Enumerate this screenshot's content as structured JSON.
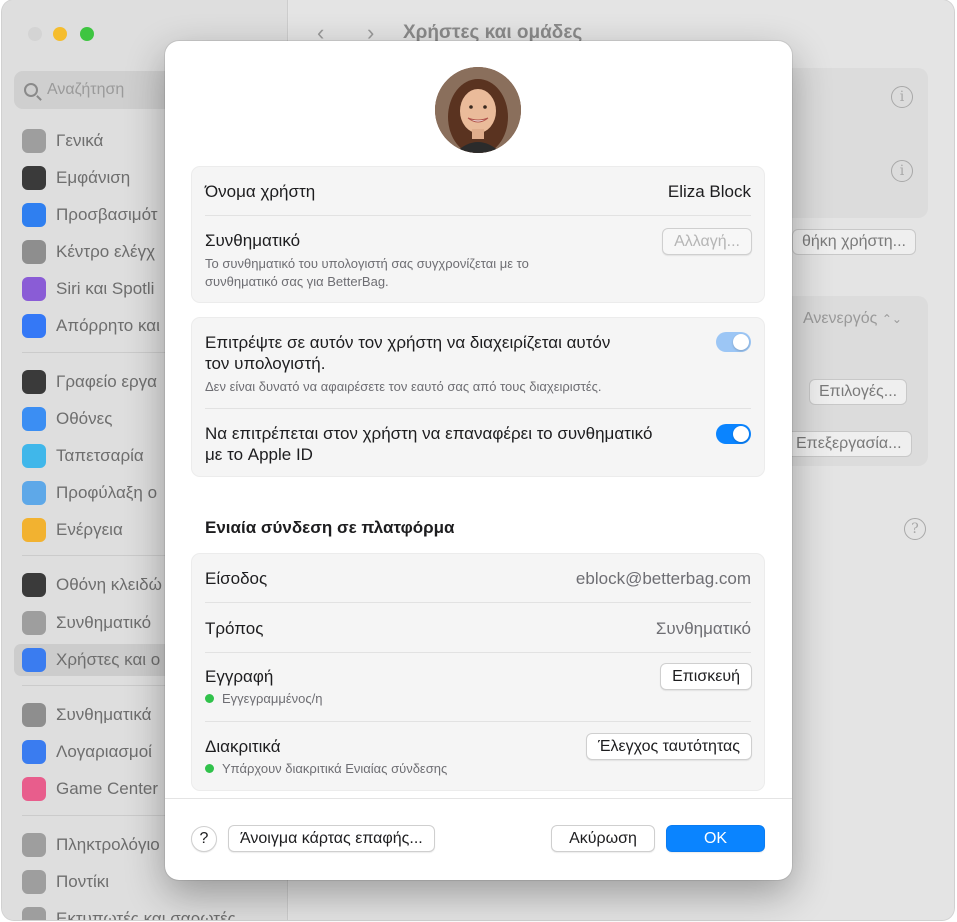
{
  "window": {
    "title": "Χρήστες και ομάδες"
  },
  "search": {
    "placeholder": "Αναζήτηση"
  },
  "sidebar": {
    "items": [
      {
        "label": "Γενικά",
        "icon": "gear-icon",
        "color": "#9e9e9e"
      },
      {
        "label": "Εμφάνιση",
        "icon": "appearance-icon",
        "color": "#3a3a3a"
      },
      {
        "label": "Προσβασιμότ",
        "icon": "accessibility-icon",
        "color": "#2f7ff0"
      },
      {
        "label": "Κέντρο ελέγχ",
        "icon": "control-center-icon",
        "color": "#8e8e8e"
      },
      {
        "label": "Siri και Spotli",
        "icon": "siri-icon",
        "color": "#8a5cd6"
      },
      {
        "label": "Απόρρητο και",
        "icon": "hand-icon",
        "color": "#3478f6"
      },
      {
        "label": "Γραφείο εργα",
        "icon": "desktop-icon",
        "color": "#3a3a3a"
      },
      {
        "label": "Οθόνες",
        "icon": "displays-icon",
        "color": "#3b8ef3"
      },
      {
        "label": "Ταπετσαρία",
        "icon": "wallpaper-icon",
        "color": "#40b7ea"
      },
      {
        "label": "Προφύλαξη ο",
        "icon": "screensaver-icon",
        "color": "#5ea8e8"
      },
      {
        "label": "Ενέργεια",
        "icon": "energy-icon",
        "color": "#f2b230"
      },
      {
        "label": "Οθόνη κλειδώ",
        "icon": "lock-screen-icon",
        "color": "#3a3a3a"
      },
      {
        "label": "Συνθηματικό",
        "icon": "password-lock-icon",
        "color": "#9e9e9e"
      },
      {
        "label": "Χρήστες και ο",
        "icon": "users-icon",
        "color": "#3a7cf0"
      },
      {
        "label": "Συνθηματικά",
        "icon": "key-icon",
        "color": "#8e8e8e"
      },
      {
        "label": "Λογαριασμοί",
        "icon": "at-icon",
        "color": "#3a7cf0"
      },
      {
        "label": "Game Center",
        "icon": "game-center-icon",
        "color": "#e85d8c"
      },
      {
        "label": "Πληκτρολόγιο",
        "icon": "keyboard-icon",
        "color": "#9e9e9e"
      },
      {
        "label": "Ποντίκι",
        "icon": "mouse-icon",
        "color": "#9e9e9e"
      },
      {
        "label": "Εκτυπωτές και σαρωτές",
        "icon": "printer-icon",
        "color": "#9e9e9e"
      }
    ]
  },
  "background": {
    "add_user_label": "θήκη χρήστη...",
    "auto_login_value": "Ανενεργός",
    "options_label": "Επιλογές...",
    "edit_label": "Επεξεργασία..."
  },
  "dialog": {
    "username_label": "Όνομα χρήστη",
    "username_value": "Eliza Block",
    "password_label": "Συνθηματικό",
    "password_sub_1": "Το συνθηματικό του υπολογιστή σας συγχρονίζεται με το",
    "password_sub_2": "συνθηματικό σας για BetterBag.",
    "change_button": "Αλλαγή...",
    "admin_label_1": "Επιτρέψτε σε αυτόν τον χρήστη να διαχειρίζεται αυτόν",
    "admin_label_2": "τον υπολογιστή.",
    "admin_sub": "Δεν είναι δυνατό να αφαιρέσετε τον εαυτό σας από τους διαχειριστές.",
    "admin_toggle_on": true,
    "reset_label_1": "Να επιτρέπεται στον χρήστη να επαναφέρει το συνθηματικό",
    "reset_label_2": "με το Apple ID",
    "reset_toggle_on": true,
    "sso_title": "Ενιαία σύνδεση σε πλατφόρμα",
    "login_label": "Είσοδος",
    "login_value": "eblock@betterbag.com",
    "method_label": "Τρόπος",
    "method_value": "Συνθηματικό",
    "registration_label": "Εγγραφή",
    "registration_status": "Εγγεγραμμένος/η",
    "repair_button": "Επισκευή",
    "tokens_label": "Διακριτικά",
    "tokens_status": "Υπάρχουν διακριτικά Ενιαίας σύνδεσης",
    "check_identity_button": "Έλεγχος ταυτότητας",
    "help_label": "?",
    "open_contact_button": "Άνοιγμα κάρτας επαφής...",
    "cancel_button": "Ακύρωση",
    "ok_button": "OK"
  }
}
